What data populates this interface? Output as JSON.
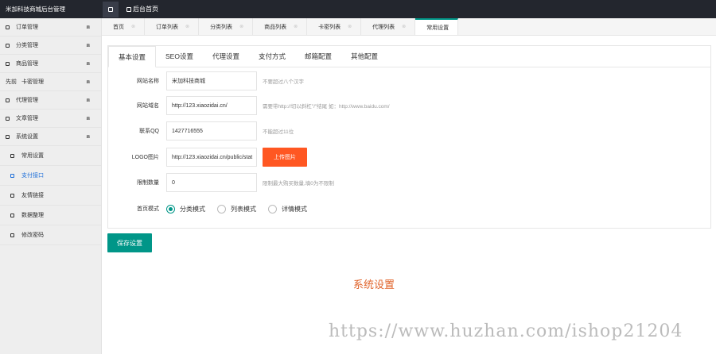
{
  "topbar": {
    "brand": "米加科技商城后台管理",
    "home_label": "后台首页"
  },
  "sidebar": {
    "items": [
      {
        "label": "订单管理",
        "expand": "⧈"
      },
      {
        "label": "分类管理",
        "expand": "⧈"
      },
      {
        "label": "商品管理",
        "expand": "⧈"
      },
      {
        "label": "卡密管理",
        "prefix": "先前",
        "expand": "⧈"
      },
      {
        "label": "代理管理",
        "expand": "⧈"
      },
      {
        "label": "文章管理",
        "expand": "⧈"
      },
      {
        "label": "系统设置",
        "expand": "⧈"
      }
    ],
    "subitems": [
      {
        "label": "常用设置"
      },
      {
        "label": "支付接口"
      },
      {
        "label": "友情链接"
      },
      {
        "label": "数据整理"
      },
      {
        "label": "修改密码"
      }
    ]
  },
  "tabs": [
    {
      "label": "首页"
    },
    {
      "label": "订单列表"
    },
    {
      "label": "分类列表"
    },
    {
      "label": "商品列表"
    },
    {
      "label": "卡密列表"
    },
    {
      "label": "代理列表"
    },
    {
      "label": "常用设置"
    }
  ],
  "tab_close": "⊗",
  "settings": {
    "tabs": [
      "基本设置",
      "SEO设置",
      "代理设置",
      "支付方式",
      "邮箱配置",
      "其他配置"
    ],
    "site_name": {
      "label": "网站名称",
      "value": "米加科技商城",
      "hint": "不要超过八个汉字"
    },
    "domain": {
      "label": "网站域名",
      "value": "http://123.xiaozidai.cn/",
      "hint": "需要带http://切以斜杠\"/\"结尾 如：http://www.baidu.com/"
    },
    "qq": {
      "label": "联系QQ",
      "value": "1427716555",
      "hint": "不能超过11位"
    },
    "logo": {
      "label": "LOGO图片",
      "value": "http://123.xiaozidai.cn/public/stat",
      "upload": "上传图片"
    },
    "limit": {
      "label": "限制数量",
      "value": "0",
      "hint": "限制最大购买数量,填0为不限制"
    },
    "homepage": {
      "label": "首页模式",
      "options": [
        "分类模式",
        "列表模式",
        "详情模式"
      ],
      "selected": "分类模式"
    }
  },
  "save_label": "保存设置",
  "caption": "系统设置",
  "watermark": "https://www.huzhan.com/ishop21204"
}
